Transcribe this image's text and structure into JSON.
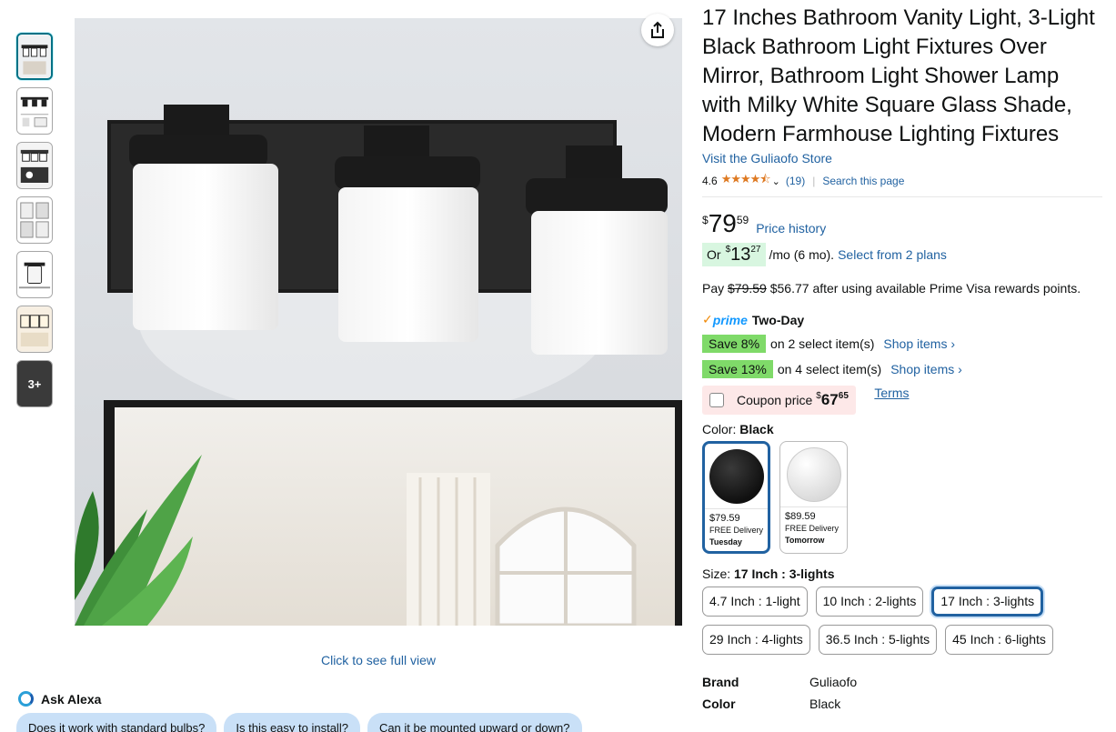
{
  "thumbnails": [
    {
      "id": "t1",
      "selected": true
    },
    {
      "id": "t2",
      "selected": false
    },
    {
      "id": "t3",
      "selected": false
    },
    {
      "id": "t4",
      "selected": false
    },
    {
      "id": "t5",
      "selected": false
    },
    {
      "id": "t6",
      "selected": false
    }
  ],
  "thumb_more_label": "3+",
  "image": {
    "full_view_label": "Click to see full view",
    "share_icon": "share-icon"
  },
  "alexa": {
    "label": "Ask Alexa",
    "chips": [
      "Does it work with standard bulbs?",
      "Is this easy to install?",
      "Can it be mounted upward or down?"
    ]
  },
  "product": {
    "title": "17 Inches Bathroom Vanity Light, 3-Light Black Bathroom Light Fixtures Over Mirror, Bathroom Light Shower Lamp with Milky White Square Glass Shade, Modern Farmhouse Lighting Fixtures",
    "store_link": "Visit the Guliaofo Store",
    "rating": "4.6",
    "stars_glyph": "★★★★⯪",
    "review_count": "(19)",
    "search_page": "Search this page"
  },
  "price": {
    "currency": "$",
    "whole": "79",
    "fraction": "59",
    "history_link": "Price history",
    "monthly_prefix": "Or",
    "monthly_whole": "13",
    "monthly_fraction": "27",
    "monthly_suffix": "/mo (6 mo).",
    "plans_link": "Select from 2 plans",
    "pay_prefix": "Pay",
    "pay_original": "$79.59",
    "pay_text": "$56.77 after using available Prime Visa rewards points."
  },
  "prime": {
    "check": "✓",
    "word": "prime",
    "label": "Two-Day"
  },
  "promos": [
    {
      "badge": "Save 8%",
      "text": "on 2 select item(s)",
      "link": "Shop items ›"
    },
    {
      "badge": "Save 13%",
      "text": "on 4 select item(s)",
      "link": "Shop items ›"
    }
  ],
  "coupon": {
    "label": "Coupon price",
    "currency": "$",
    "whole": "67",
    "fraction": "65",
    "terms": "Terms"
  },
  "color": {
    "label": "Color:",
    "selected": "Black",
    "options": [
      {
        "name": "Black",
        "price": "$79.59",
        "delivery": "FREE Delivery",
        "day": "Tuesday",
        "selected": true
      },
      {
        "name": "White",
        "price": "$89.59",
        "delivery": "FREE Delivery",
        "day": "Tomorrow",
        "selected": false
      }
    ]
  },
  "size": {
    "label": "Size:",
    "selected": "17 Inch : 3-lights",
    "options": [
      "4.7 Inch : 1-light",
      "10 Inch : 2-lights",
      "17 Inch : 3-lights",
      "29 Inch : 4-lights",
      "36.5 Inch : 5-lights",
      "45 Inch : 6-lights"
    ],
    "selected_index": 2
  },
  "specs": [
    {
      "key": "Brand",
      "value": "Guliaofo"
    },
    {
      "key": "Color",
      "value": "Black"
    }
  ],
  "colors": {
    "link": "#2162a1",
    "deal_green": "#7fda69",
    "coupon_bg": "#fde8e8",
    "selected_border": "#2162a1"
  }
}
